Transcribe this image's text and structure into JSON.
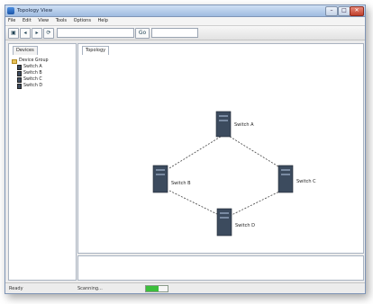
{
  "window": {
    "title": "Topology View",
    "min_glyph": "–",
    "max_glyph": "□",
    "close_glyph": "✕"
  },
  "menubar": {
    "items": [
      "File",
      "Edit",
      "View",
      "Tools",
      "Options",
      "Help"
    ]
  },
  "toolbar": {
    "address_value": "",
    "search_value": "",
    "buttons": [
      "▣",
      "◂",
      "▸",
      "⟳"
    ],
    "go_label": "Go"
  },
  "sidebar": {
    "tab_label": "Devices",
    "tree": [
      {
        "label": "Device Group",
        "type": "folder"
      },
      {
        "label": "Switch A",
        "type": "device"
      },
      {
        "label": "Switch B",
        "type": "device"
      },
      {
        "label": "Switch C",
        "type": "device"
      },
      {
        "label": "Switch D",
        "type": "device"
      }
    ]
  },
  "main": {
    "tab_label": "Topology"
  },
  "topology": {
    "nodes": [
      {
        "id": "top",
        "label": "Switch A"
      },
      {
        "id": "left",
        "label": "Switch B"
      },
      {
        "id": "right",
        "label": "Switch C"
      },
      {
        "id": "bottom",
        "label": "Switch D"
      }
    ],
    "links": [
      [
        "top",
        "left"
      ],
      [
        "top",
        "right"
      ],
      [
        "left",
        "bottom"
      ],
      [
        "right",
        "bottom"
      ]
    ]
  },
  "status": {
    "left_text": "Ready",
    "mid_text": "Scanning...",
    "progress_fraction": 0.6,
    "progress_color": "#3cbf3c"
  },
  "colors": {
    "titlebar": "#9fbbe0",
    "link": "#555555",
    "device": "#3c4b5e"
  }
}
